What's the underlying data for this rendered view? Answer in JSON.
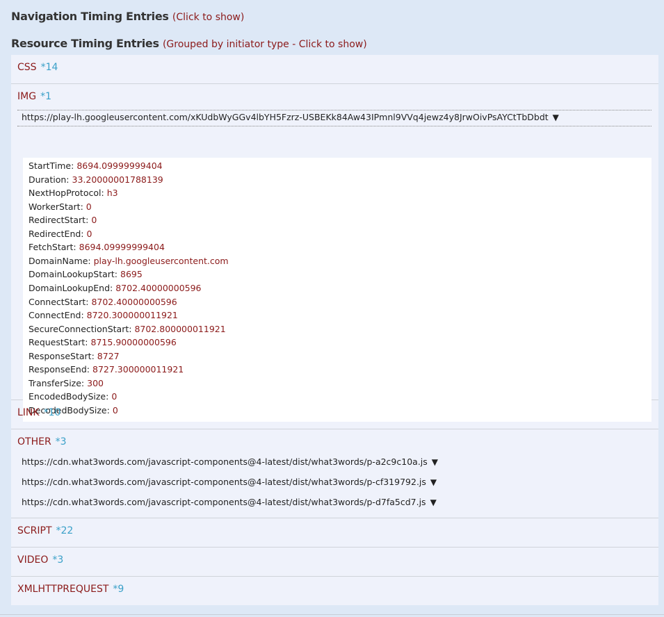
{
  "navigation": {
    "title": "Navigation Timing Entries",
    "hint": "(Click to show)"
  },
  "resource": {
    "title": "Resource Timing Entries",
    "hint": "(Grouped by initiator type - Click to show)"
  },
  "groups": {
    "css": {
      "name": "CSS",
      "count": "*14"
    },
    "img": {
      "name": "IMG",
      "count": "*1",
      "url": "https://play-lh.googleusercontent.com/xKUdbWyGGv4lbYH5Fzrz-USBEKk84Aw43IPmnl9VVq4jewz4y8JrwOivPsAYCtTbDbdt",
      "details": [
        {
          "k": "StartTime:",
          "v": "8694.09999999404"
        },
        {
          "k": "Duration:",
          "v": "33.20000001788139"
        },
        {
          "k": "NextHopProtocol:",
          "v": "h3"
        },
        {
          "k": "WorkerStart:",
          "v": "0"
        },
        {
          "k": "RedirectStart:",
          "v": "0"
        },
        {
          "k": "RedirectEnd:",
          "v": "0"
        },
        {
          "k": "FetchStart:",
          "v": "8694.09999999404"
        },
        {
          "k": "DomainName:",
          "v": "play-lh.googleusercontent.com"
        },
        {
          "k": "DomainLookupStart:",
          "v": "8695"
        },
        {
          "k": "DomainLookupEnd:",
          "v": "8702.40000000596"
        },
        {
          "k": "ConnectStart:",
          "v": "8702.40000000596"
        },
        {
          "k": "ConnectEnd:",
          "v": "8720.300000011921"
        },
        {
          "k": "SecureConnectionStart:",
          "v": "8702.800000011921"
        },
        {
          "k": "RequestStart:",
          "v": "8715.90000000596"
        },
        {
          "k": "ResponseStart:",
          "v": "8727"
        },
        {
          "k": "ResponseEnd:",
          "v": "8727.300000011921"
        },
        {
          "k": "TransferSize:",
          "v": "300"
        },
        {
          "k": "EncodedBodySize:",
          "v": "0"
        },
        {
          "k": "DecodedBodySize:",
          "v": "0"
        }
      ]
    },
    "link": {
      "name": "LINK",
      "count": "*10"
    },
    "other": {
      "name": "OTHER",
      "count": "*3",
      "urls": [
        "https://cdn.what3words.com/javascript-components@4-latest/dist/what3words/p-a2c9c10a.js",
        "https://cdn.what3words.com/javascript-components@4-latest/dist/what3words/p-cf319792.js",
        "https://cdn.what3words.com/javascript-components@4-latest/dist/what3words/p-d7fa5cd7.js"
      ]
    },
    "script": {
      "name": "SCRIPT",
      "count": "*22"
    },
    "video": {
      "name": "VIDEO",
      "count": "*3"
    },
    "xhr": {
      "name": "XMLHTTPREQUEST",
      "count": "*9"
    }
  },
  "caret": "▼"
}
